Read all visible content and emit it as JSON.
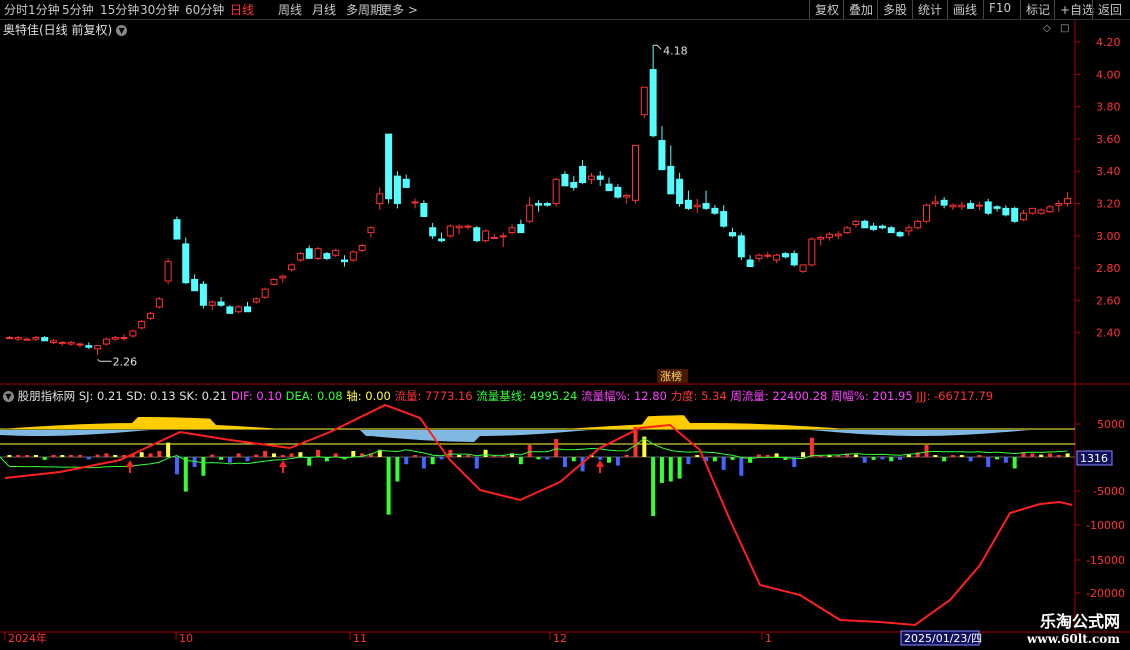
{
  "toolbar": {
    "left": [
      "分时",
      "1分钟",
      "5分钟",
      "15分钟",
      "30分钟",
      "60分钟",
      "日线",
      "周线",
      "月线",
      "多周期",
      "更多 >"
    ],
    "active": "日线",
    "right": [
      "复权",
      "叠加",
      "多股",
      "统计",
      "画线",
      "F10",
      "标记",
      "+自选",
      "返回"
    ]
  },
  "main": {
    "title": "奥特佳(日线 前复权)",
    "high_label": "4.18",
    "low_label": "2.26",
    "tag": "涨榜",
    "yticks": [
      "4.20",
      "4.00",
      "3.80",
      "3.60",
      "3.40",
      "3.20",
      "3.00",
      "2.80",
      "2.60",
      "2.40"
    ]
  },
  "indicator": {
    "name": "股朋指标网",
    "items": [
      {
        "label": "SJ: 0.21",
        "color": "#e0e0e0"
      },
      {
        "label": "SD: 0.13",
        "color": "#e0e0e0"
      },
      {
        "label": "SK: 0.21",
        "color": "#e0e0e0"
      },
      {
        "label": "DIF: 0.10",
        "color": "#ff44ff"
      },
      {
        "label": "DEA: 0.08",
        "color": "#33ff33"
      },
      {
        "label": "轴: 0.00",
        "color": "#ffff44"
      },
      {
        "label": "流量: 7773.16",
        "color": "#ff3333"
      },
      {
        "label": "流量基线: 4995.24",
        "color": "#33ff33"
      },
      {
        "label": "流量幅%: 12.80",
        "color": "#ff44ff"
      },
      {
        "label": "力度: 5.34",
        "color": "#ff3333"
      },
      {
        "label": "周流量: 22400.28",
        "color": "#ff44ff"
      },
      {
        "label": "周幅%: 201.95",
        "color": "#ff44ff"
      },
      {
        "label": "JJJ: -66717.79",
        "color": "#ff3333"
      }
    ],
    "yticks": [
      "5000",
      "-5000",
      "-10000",
      "-15000",
      "-20000"
    ],
    "current_value": "1316"
  },
  "date_axis": {
    "labels": [
      "2024年",
      "10",
      "11",
      "12",
      "1"
    ],
    "cursor_date": "2025/01/23/四"
  },
  "watermark": {
    "line1": "乐淘公式网",
    "line2": "www.60lt.com"
  },
  "colors": {
    "up": "#ff3232",
    "down": "#54ffff",
    "axis": "#b00000",
    "label_red": "#ff3333"
  },
  "chart_data": {
    "type": "candlestick",
    "ylim": [
      2.2,
      4.25
    ],
    "candles": [
      [
        2.37,
        2.38,
        2.36,
        2.37
      ],
      [
        2.36,
        2.38,
        2.35,
        2.37
      ],
      [
        2.36,
        2.37,
        2.35,
        2.36
      ],
      [
        2.36,
        2.38,
        2.35,
        2.37
      ],
      [
        2.37,
        2.38,
        2.35,
        2.35
      ],
      [
        2.34,
        2.36,
        2.33,
        2.35
      ],
      [
        2.34,
        2.35,
        2.32,
        2.34
      ],
      [
        2.33,
        2.35,
        2.32,
        2.34
      ],
      [
        2.33,
        2.34,
        2.31,
        2.33
      ],
      [
        2.32,
        2.34,
        2.3,
        2.31
      ],
      [
        2.3,
        2.32,
        2.26,
        2.32
      ],
      [
        2.33,
        2.37,
        2.32,
        2.36
      ],
      [
        2.36,
        2.38,
        2.35,
        2.37
      ],
      [
        2.37,
        2.39,
        2.35,
        2.37
      ],
      [
        2.38,
        2.42,
        2.37,
        2.41
      ],
      [
        2.43,
        2.48,
        2.42,
        2.47
      ],
      [
        2.49,
        2.53,
        2.48,
        2.52
      ],
      [
        2.56,
        2.62,
        2.55,
        2.61
      ],
      [
        2.72,
        2.86,
        2.7,
        2.84
      ],
      [
        3.1,
        3.12,
        2.98,
        2.98
      ],
      [
        2.95,
        2.99,
        2.7,
        2.71
      ],
      [
        2.73,
        2.76,
        2.66,
        2.66
      ],
      [
        2.7,
        2.72,
        2.55,
        2.57
      ],
      [
        2.57,
        2.6,
        2.54,
        2.59
      ],
      [
        2.59,
        2.62,
        2.56,
        2.57
      ],
      [
        2.56,
        2.57,
        2.52,
        2.52
      ],
      [
        2.53,
        2.57,
        2.52,
        2.56
      ],
      [
        2.56,
        2.59,
        2.53,
        2.53
      ],
      [
        2.59,
        2.62,
        2.58,
        2.61
      ],
      [
        2.62,
        2.68,
        2.61,
        2.67
      ],
      [
        2.7,
        2.74,
        2.69,
        2.73
      ],
      [
        2.74,
        2.76,
        2.71,
        2.75
      ],
      [
        2.79,
        2.83,
        2.78,
        2.82
      ],
      [
        2.85,
        2.9,
        2.84,
        2.89
      ],
      [
        2.92,
        2.94,
        2.86,
        2.86
      ],
      [
        2.86,
        2.93,
        2.85,
        2.92
      ],
      [
        2.89,
        2.9,
        2.85,
        2.86
      ],
      [
        2.88,
        2.92,
        2.87,
        2.91
      ],
      [
        2.85,
        2.88,
        2.81,
        2.84
      ],
      [
        2.85,
        2.91,
        2.84,
        2.9
      ],
      [
        2.91,
        2.95,
        2.9,
        2.94
      ],
      [
        3.02,
        3.06,
        2.99,
        3.05
      ],
      [
        3.2,
        3.3,
        3.16,
        3.26
      ],
      [
        3.63,
        3.63,
        3.2,
        3.23
      ],
      [
        3.37,
        3.4,
        3.17,
        3.2
      ],
      [
        3.35,
        3.38,
        3.3,
        3.3
      ],
      [
        3.21,
        3.23,
        3.17,
        3.21
      ],
      [
        3.2,
        3.22,
        3.12,
        3.12
      ],
      [
        3.05,
        3.08,
        2.98,
        3.0
      ],
      [
        2.98,
        3.02,
        2.96,
        2.97
      ],
      [
        3.0,
        3.07,
        2.99,
        3.06
      ],
      [
        3.05,
        3.07,
        3.01,
        3.06
      ],
      [
        3.06,
        3.07,
        3.04,
        3.06
      ],
      [
        3.05,
        3.06,
        2.96,
        2.97
      ],
      [
        2.97,
        3.04,
        2.96,
        3.03
      ],
      [
        2.99,
        3.01,
        2.98,
        2.99
      ],
      [
        3.0,
        3.02,
        2.93,
        3.0
      ],
      [
        3.02,
        3.07,
        3.01,
        3.05
      ],
      [
        3.07,
        3.1,
        3.02,
        3.02
      ],
      [
        3.09,
        3.24,
        3.08,
        3.19
      ],
      [
        3.2,
        3.22,
        3.15,
        3.19
      ],
      [
        3.2,
        3.21,
        3.18,
        3.19
      ],
      [
        3.2,
        3.36,
        3.18,
        3.35
      ],
      [
        3.38,
        3.4,
        3.31,
        3.31
      ],
      [
        3.33,
        3.37,
        3.28,
        3.3
      ],
      [
        3.43,
        3.47,
        3.32,
        3.33
      ],
      [
        3.35,
        3.39,
        3.32,
        3.37
      ],
      [
        3.37,
        3.4,
        3.31,
        3.35
      ],
      [
        3.32,
        3.36,
        3.28,
        3.28
      ],
      [
        3.3,
        3.32,
        3.23,
        3.24
      ],
      [
        3.24,
        3.26,
        3.2,
        3.25
      ],
      [
        3.22,
        3.56,
        3.2,
        3.56
      ],
      [
        3.75,
        3.92,
        3.73,
        3.92
      ],
      [
        4.03,
        4.18,
        3.61,
        3.62
      ],
      [
        3.59,
        3.68,
        3.43,
        3.41
      ],
      [
        3.43,
        3.56,
        3.28,
        3.26
      ],
      [
        3.35,
        3.39,
        3.18,
        3.2
      ],
      [
        3.22,
        3.28,
        3.16,
        3.17
      ],
      [
        3.18,
        3.23,
        3.14,
        3.19
      ],
      [
        3.2,
        3.28,
        3.16,
        3.17
      ],
      [
        3.17,
        3.19,
        3.13,
        3.14
      ],
      [
        3.15,
        3.19,
        3.05,
        3.06
      ],
      [
        3.02,
        3.05,
        2.99,
        3.0
      ],
      [
        3.0,
        3.02,
        2.85,
        2.87
      ],
      [
        2.85,
        2.88,
        2.81,
        2.81
      ],
      [
        2.86,
        2.89,
        2.84,
        2.88
      ],
      [
        2.88,
        2.9,
        2.86,
        2.88
      ],
      [
        2.85,
        2.89,
        2.83,
        2.88
      ],
      [
        2.89,
        2.9,
        2.86,
        2.87
      ],
      [
        2.89,
        2.91,
        2.81,
        2.82
      ],
      [
        2.78,
        2.82,
        2.77,
        2.82
      ],
      [
        2.82,
        2.99,
        2.81,
        2.98
      ],
      [
        2.98,
        3.0,
        2.94,
        2.99
      ],
      [
        2.99,
        3.02,
        2.97,
        3.01
      ],
      [
        3.0,
        3.03,
        2.98,
        3.01
      ],
      [
        3.02,
        3.06,
        3.01,
        3.05
      ],
      [
        3.07,
        3.1,
        3.05,
        3.09
      ],
      [
        3.09,
        3.1,
        3.05,
        3.05
      ],
      [
        3.06,
        3.08,
        3.03,
        3.04
      ],
      [
        3.06,
        3.07,
        3.04,
        3.05
      ],
      [
        3.05,
        3.06,
        3.02,
        3.02
      ],
      [
        3.02,
        3.03,
        2.99,
        3.0
      ],
      [
        3.03,
        3.07,
        3.0,
        3.05
      ],
      [
        3.05,
        3.1,
        3.04,
        3.09
      ],
      [
        3.09,
        3.2,
        3.08,
        3.19
      ],
      [
        3.2,
        3.25,
        3.18,
        3.21
      ],
      [
        3.22,
        3.24,
        3.17,
        3.19
      ],
      [
        3.18,
        3.2,
        3.16,
        3.19
      ],
      [
        3.18,
        3.21,
        3.16,
        3.19
      ],
      [
        3.2,
        3.22,
        3.17,
        3.17
      ],
      [
        3.19,
        3.21,
        3.16,
        3.19
      ],
      [
        3.21,
        3.23,
        3.13,
        3.14
      ],
      [
        3.18,
        3.19,
        3.15,
        3.17
      ],
      [
        3.17,
        3.19,
        3.12,
        3.13
      ],
      [
        3.17,
        3.18,
        3.08,
        3.09
      ],
      [
        3.1,
        3.16,
        3.09,
        3.14
      ],
      [
        3.14,
        3.17,
        3.13,
        3.17
      ],
      [
        3.14,
        3.17,
        3.13,
        3.16
      ],
      [
        3.15,
        3.19,
        3.14,
        3.18
      ],
      [
        3.19,
        3.22,
        3.15,
        3.2
      ],
      [
        3.2,
        3.27,
        3.18,
        3.23
      ]
    ]
  }
}
